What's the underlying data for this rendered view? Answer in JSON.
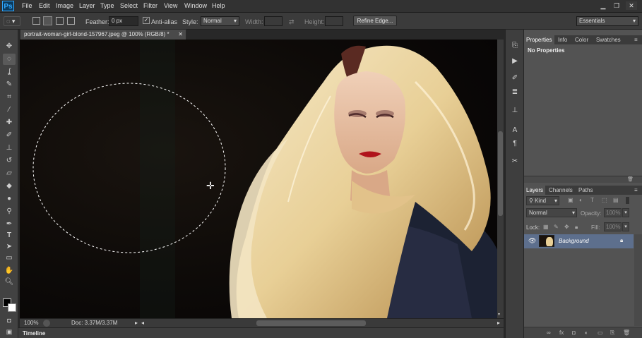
{
  "app": {
    "logo": "Ps",
    "menu": [
      "File",
      "Edit",
      "Image",
      "Layer",
      "Type",
      "Select",
      "Filter",
      "View",
      "Window",
      "Help"
    ],
    "window_controls": [
      "minimize-icon",
      "restore-icon",
      "close-icon"
    ]
  },
  "options_bar": {
    "feather_label": "Feather:",
    "feather_value": "0 px",
    "antialias_label": "Anti-alias",
    "antialias_checked": true,
    "style_label": "Style:",
    "style_value": "Normal",
    "width_label": "Width:",
    "height_label": "Height:",
    "refine_edge_label": "Refine Edge...",
    "workspace_value": "Essentials"
  },
  "document": {
    "tab_title": "portrait-woman-girl-blond-157967.jpeg @ 100% (RGB/8) *",
    "zoom": "100%",
    "doc_info": "Doc: 3.37M/3.37M"
  },
  "timeline_label": "Timeline",
  "properties_panel": {
    "tabs": [
      "Properties",
      "Info",
      "Color",
      "Swatches"
    ],
    "active_tab": "Properties",
    "content": "No Properties"
  },
  "layers_panel": {
    "tabs": [
      "Layers",
      "Channels",
      "Paths"
    ],
    "active_tab": "Layers",
    "filter_value": "Kind",
    "blend_mode": "Normal",
    "opacity_label": "Opacity:",
    "opacity_value": "100%",
    "lock_label": "Lock:",
    "fill_label": "Fill:",
    "fill_value": "100%",
    "layers": [
      {
        "name": "Background",
        "visible": true,
        "locked": true
      }
    ]
  },
  "colors": {
    "accent": "#31a8ff",
    "selected_layer": "#5d6f8d"
  }
}
